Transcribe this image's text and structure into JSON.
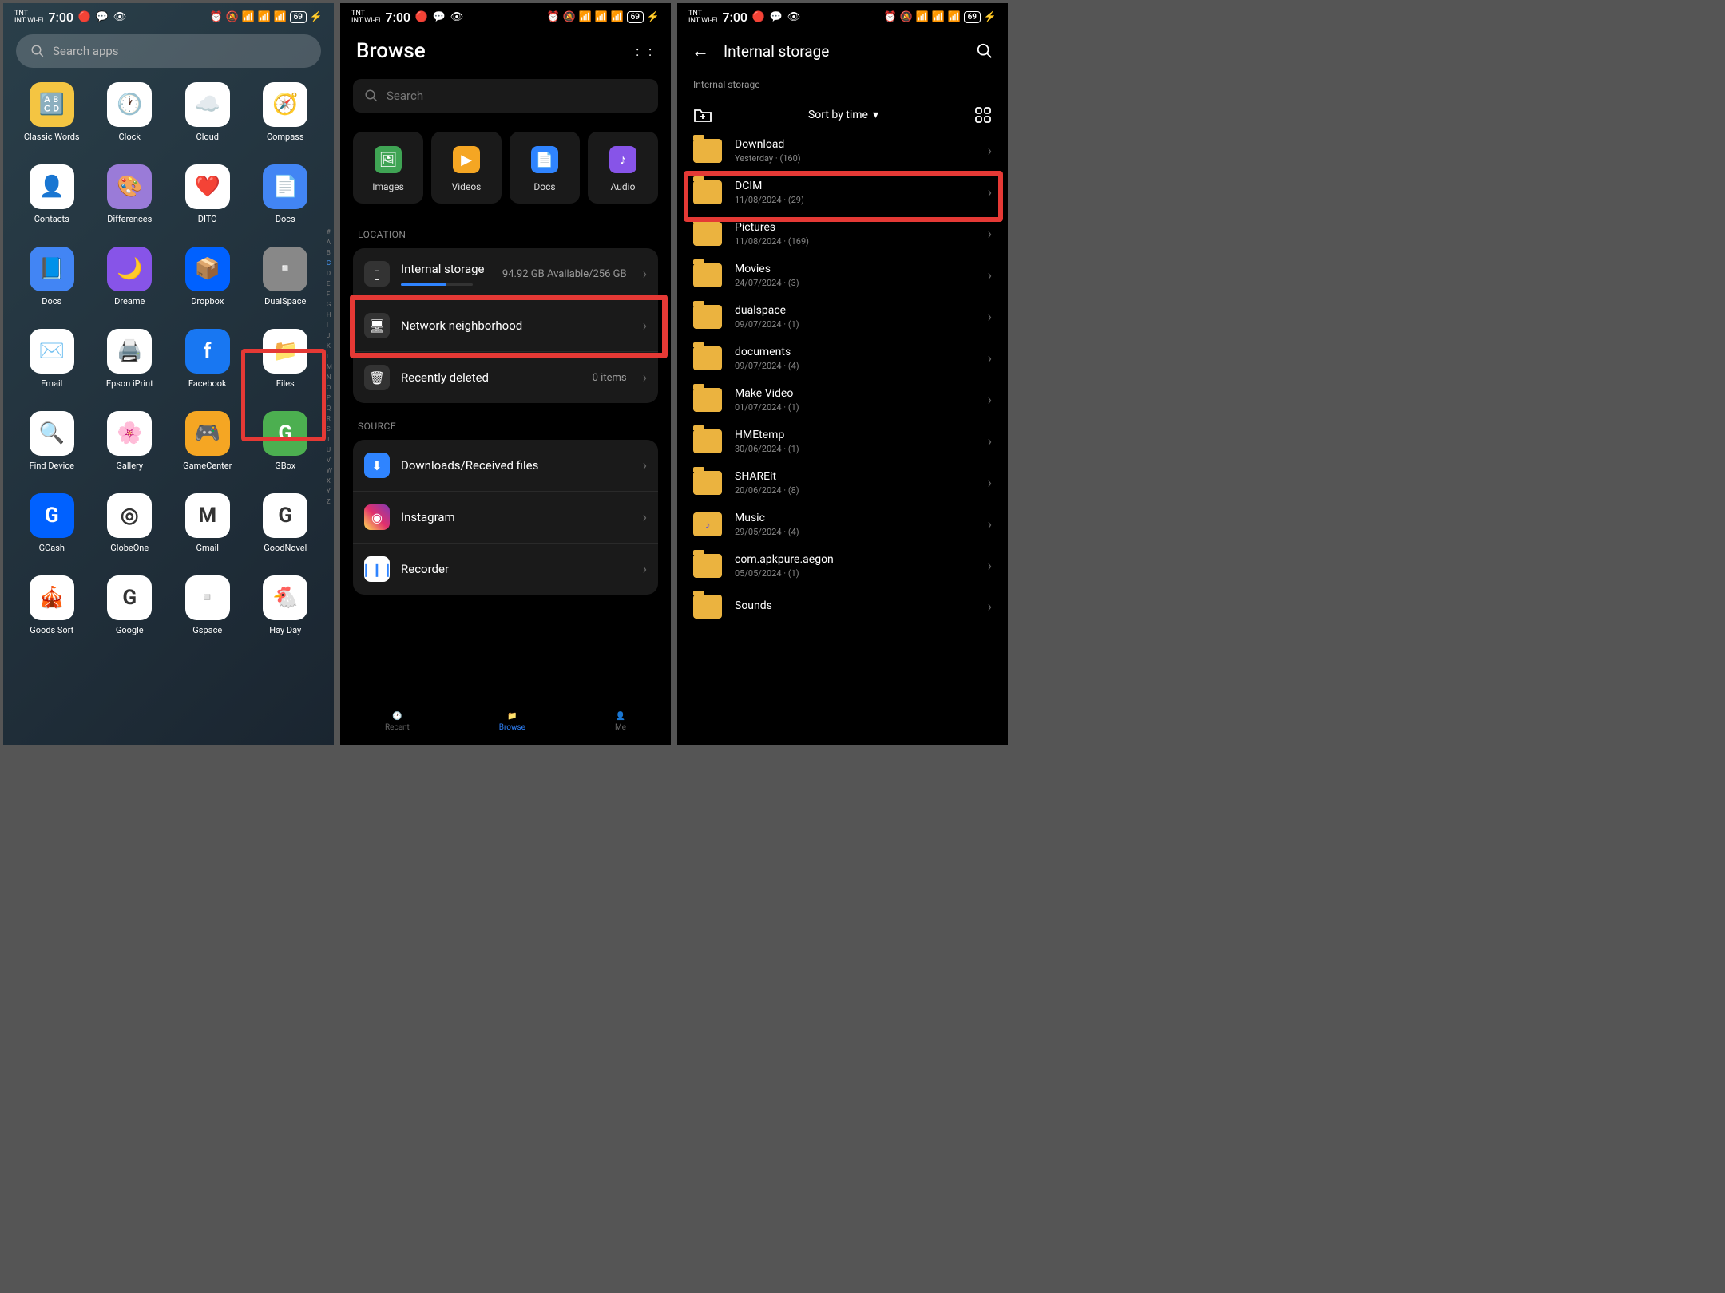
{
  "status": {
    "carrier": "TNT",
    "wifi_label": "INT WI-FI",
    "time": "7:00",
    "battery": "69"
  },
  "screen1": {
    "search_placeholder": "Search apps",
    "apps": [
      {
        "label": "Classic Words",
        "icon": "🔠",
        "bg": "#f4c542"
      },
      {
        "label": "Clock",
        "icon": "🕐",
        "bg": "#fff"
      },
      {
        "label": "Cloud",
        "icon": "☁️",
        "bg": "#fff"
      },
      {
        "label": "Compass",
        "icon": "🧭",
        "bg": "#fff"
      },
      {
        "label": "Contacts",
        "icon": "👤",
        "bg": "#fff"
      },
      {
        "label": "Differences",
        "icon": "🎨",
        "bg": "#9a7bd8"
      },
      {
        "label": "DITO",
        "icon": "❤️",
        "bg": "#fff"
      },
      {
        "label": "Docs",
        "icon": "📄",
        "bg": "#4285f4"
      },
      {
        "label": "Docs",
        "icon": "📘",
        "bg": "#4285f4"
      },
      {
        "label": "Dreame",
        "icon": "🌙",
        "bg": "#8754e8"
      },
      {
        "label": "Dropbox",
        "icon": "📦",
        "bg": "#0061ff"
      },
      {
        "label": "DualSpace",
        "icon": "▫️",
        "bg": "#888"
      },
      {
        "label": "Email",
        "icon": "✉️",
        "bg": "#fff"
      },
      {
        "label": "Epson iPrint",
        "icon": "🖨️",
        "bg": "#fff"
      },
      {
        "label": "Facebook",
        "icon": "f",
        "bg": "#1877f2"
      },
      {
        "label": "Files",
        "icon": "📁",
        "bg": "#fff"
      },
      {
        "label": "Find Device",
        "icon": "🔍",
        "bg": "#fff"
      },
      {
        "label": "Gallery",
        "icon": "🌸",
        "bg": "#fff"
      },
      {
        "label": "GameCenter",
        "icon": "🎮",
        "bg": "#f5a623"
      },
      {
        "label": "GBox",
        "icon": "G",
        "bg": "#4caf50"
      },
      {
        "label": "GCash",
        "icon": "G",
        "bg": "#0061ff"
      },
      {
        "label": "GlobeOne",
        "icon": "◎",
        "bg": "#fff"
      },
      {
        "label": "Gmail",
        "icon": "M",
        "bg": "#fff"
      },
      {
        "label": "GoodNovel",
        "icon": "G",
        "bg": "#fff"
      },
      {
        "label": "Goods Sort",
        "icon": "🎪",
        "bg": "#fff"
      },
      {
        "label": "Google",
        "icon": "G",
        "bg": "#fff"
      },
      {
        "label": "Gspace",
        "icon": "▫️",
        "bg": "#fff"
      },
      {
        "label": "Hay Day",
        "icon": "🐔",
        "bg": "#fff"
      }
    ],
    "alpha": [
      "#",
      "A",
      "B",
      "C",
      "D",
      "E",
      "F",
      "G",
      "H",
      "I",
      "J",
      "K",
      "L",
      "M",
      "N",
      "O",
      "P",
      "Q",
      "R",
      "S",
      "T",
      "U",
      "V",
      "W",
      "X",
      "Y",
      "Z"
    ]
  },
  "screen2": {
    "title": "Browse",
    "search_placeholder": "Search",
    "categories": [
      {
        "label": "Images"
      },
      {
        "label": "Videos"
      },
      {
        "label": "Docs"
      },
      {
        "label": "Audio"
      }
    ],
    "section_location": "LOCATION",
    "internal_storage": {
      "title": "Internal storage",
      "detail": "94.92 GB Available/256 GB"
    },
    "network": {
      "title": "Network neighborhood"
    },
    "recently_deleted": {
      "title": "Recently deleted",
      "count": "0 items"
    },
    "section_source": "SOURCE",
    "sources": [
      {
        "title": "Downloads/Received files",
        "icon": "⬇",
        "bg": "#2f84ff"
      },
      {
        "title": "Instagram",
        "icon": "◉",
        "bg": "linear-gradient(45deg,#fd5,#e1306c,#833ab4)"
      },
      {
        "title": "Recorder",
        "icon": "▮",
        "bg": "#fff"
      }
    ],
    "nav": [
      {
        "label": "Recent"
      },
      {
        "label": "Browse"
      },
      {
        "label": "Me"
      }
    ]
  },
  "screen3": {
    "title": "Internal storage",
    "breadcrumb": "Internal storage",
    "sort_label": "Sort by time",
    "folders": [
      {
        "name": "Download",
        "meta": "Yesterday · (160)"
      },
      {
        "name": "DCIM",
        "meta": "11/08/2024 · (29)"
      },
      {
        "name": "Pictures",
        "meta": "11/08/2024 · (169)"
      },
      {
        "name": "Movies",
        "meta": "24/07/2024 · (3)"
      },
      {
        "name": "dualspace",
        "meta": "09/07/2024 · (1)"
      },
      {
        "name": "documents",
        "meta": "09/07/2024 · (4)"
      },
      {
        "name": "Make Video",
        "meta": "01/07/2024 · (1)"
      },
      {
        "name": "HMEtemp",
        "meta": "30/06/2024 · (1)"
      },
      {
        "name": "SHAREit",
        "meta": "20/06/2024 · (8)"
      },
      {
        "name": "Music",
        "meta": "29/05/2024 · (4)"
      },
      {
        "name": "com.apkpure.aegon",
        "meta": "05/05/2024 · (1)"
      },
      {
        "name": "Sounds",
        "meta": ""
      }
    ]
  }
}
